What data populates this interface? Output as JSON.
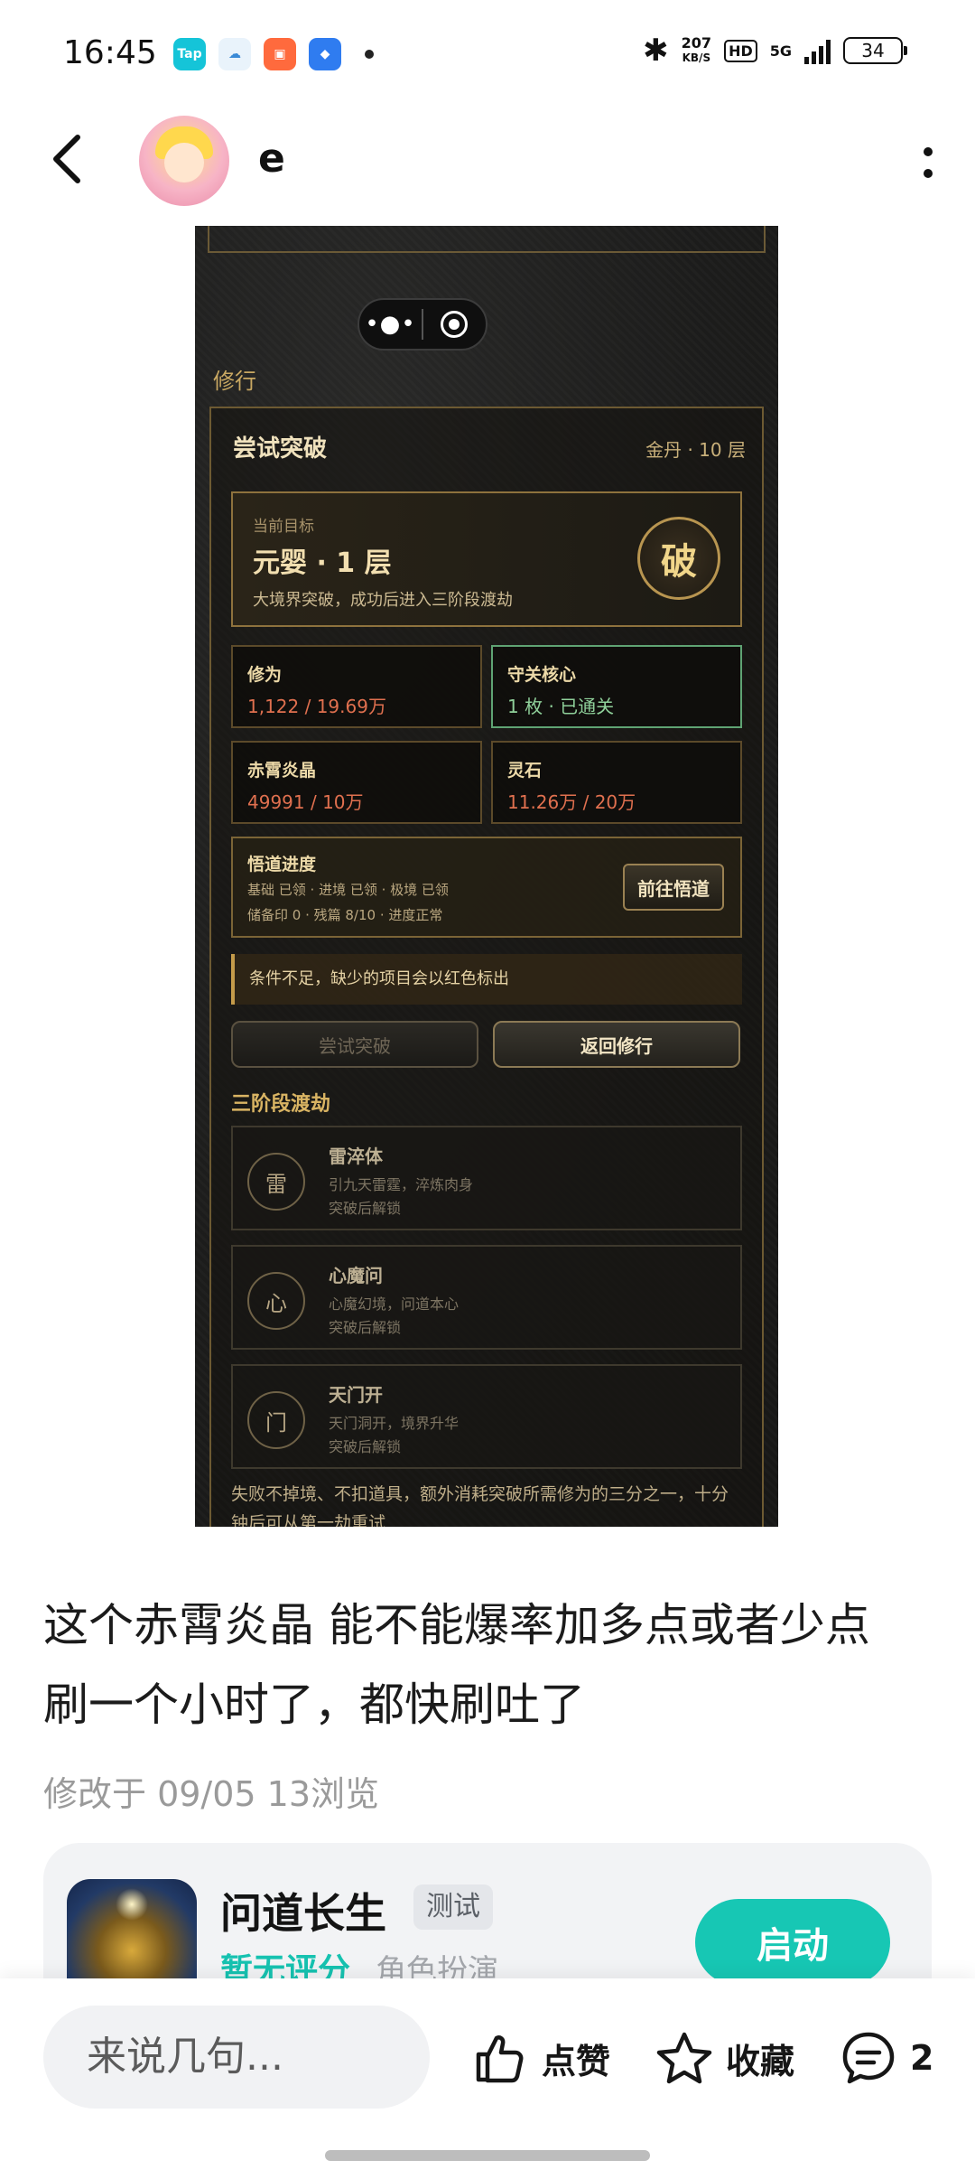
{
  "status_bar": {
    "time": "16:45",
    "app_icons": [
      "Tap",
      "weather",
      "photo-app",
      "browser"
    ],
    "speed_value": "207",
    "speed_unit": "KB/S",
    "hd": "HD",
    "network": "5G",
    "battery": "34"
  },
  "header": {
    "username": "e"
  },
  "screenshot": {
    "section_label": "修行",
    "panel_title": "尝试突破",
    "panel_tag": "金丹 · 10 层",
    "target": {
      "label": "当前目标",
      "name": "元婴 · 1 层",
      "desc": "大境界突破，成功后进入三阶段渡劫",
      "button": "破"
    },
    "stats": [
      {
        "label": "修为",
        "value": "1,122 / 19.69万"
      },
      {
        "label": "守关核心",
        "value": "1 枚 · 已通关"
      },
      {
        "label": "赤霄炎晶",
        "value": "49991 / 10万"
      },
      {
        "label": "灵石",
        "value": "11.26万 / 20万"
      }
    ],
    "wudao": {
      "title": "悟道进度",
      "line1": "基础 已领 · 进境 已领 · 极境 已领",
      "line2": "储备印 0 · 残篇 8/10 · 进度正常",
      "button": "前往悟道"
    },
    "warning": "条件不足，缺少的项目会以红色标出",
    "btn_try": "尝试突破",
    "btn_back": "返回修行",
    "tribulation_title": "三阶段渡劫",
    "tribulations": [
      {
        "glyph": "雷",
        "name": "雷淬体",
        "desc": "引九天雷霆，淬炼肉身",
        "status": "突破后解锁"
      },
      {
        "glyph": "心",
        "name": "心魔问",
        "desc": "心魔幻境，问道本心",
        "status": "突破后解锁"
      },
      {
        "glyph": "门",
        "name": "天门开",
        "desc": "天门洞开，境界升华",
        "status": "突破后解锁"
      }
    ],
    "footnote": "失败不掉境、不扣道具，额外消耗突破所需修为的三分之一，十分钟后可从第一劫重试"
  },
  "post": {
    "text_line1": "这个赤霄炎晶 能不能爆率加多点或者少点",
    "text_line2": "刷一个小时了，都快刷吐了",
    "meta": "修改于 09/05  13浏览"
  },
  "game_card": {
    "name": "问道长生",
    "badge": "测试",
    "rating": "暂无评分",
    "genre": "角色扮演",
    "launch": "启动"
  },
  "bottom_bar": {
    "comment_placeholder": "来说几句...",
    "like": "点赞",
    "favorite": "收藏",
    "comment_count": "2"
  },
  "colors": {
    "accent": "#17c7b4",
    "gold": "#c9a862",
    "danger": "#e0704f",
    "ok": "#8fd09a"
  }
}
